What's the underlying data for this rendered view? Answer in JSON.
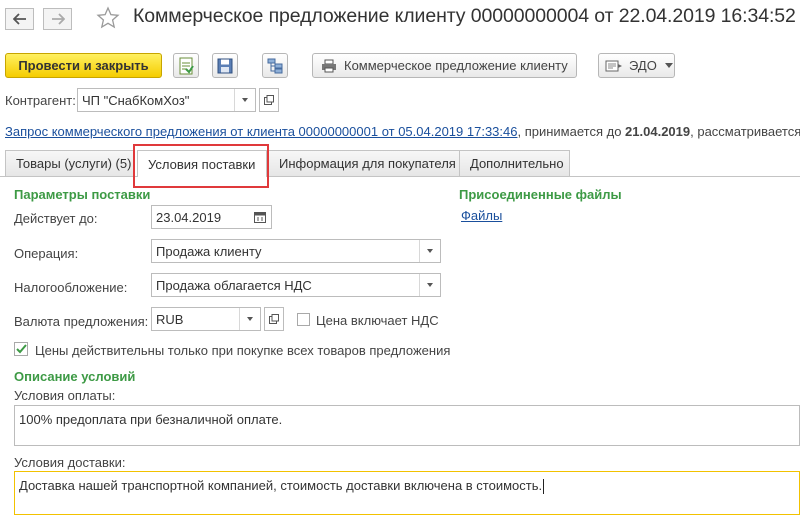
{
  "window": {
    "title": "Коммерческое предложение клиенту 00000000004 от 22.04.2019 16:34:52",
    "icons": {
      "back": "arrow-left-icon",
      "forward": "arrow-right-icon",
      "favorite": "star-icon"
    }
  },
  "toolbar": {
    "post_close_label": "Провести и закрыть",
    "print_label": "Коммерческое предложение клиенту",
    "edo_label": "ЭДО",
    "colors": {
      "primary": "#f5cc00"
    }
  },
  "counterparty": {
    "label": "Контрагент:",
    "value": "ЧП \"СнабКомХоз\""
  },
  "request_line": {
    "link": "Запрос коммерческого предложения от клиента 00000000001 от 05.04.2019 17:33:46",
    "mid_text": ", принимается до ",
    "date": "21.04.2019",
    "tail_text": ", рассматривается"
  },
  "tabs": [
    {
      "label": "Товары (услуги) (5)"
    },
    {
      "label": "Условия поставки"
    },
    {
      "label": "Информация для покупателя"
    },
    {
      "label": "Дополнительно"
    }
  ],
  "delivery_params": {
    "section_title": "Параметры поставки",
    "valid_until_label": "Действует до:",
    "valid_until_value": "23.04.2019",
    "operation_label": "Операция:",
    "operation_value": "Продажа клиенту",
    "taxation_label": "Налогообложение:",
    "taxation_value": "Продажа облагается НДС",
    "currency_label": "Валюта предложения:",
    "currency_value": "RUB",
    "price_vat_label": "Цена включает НДС",
    "price_vat_checked": false,
    "valid_all_label": "Цены действительны только при покупке всех товаров предложения",
    "valid_all_checked": true
  },
  "attached": {
    "section_title": "Присоединенные файлы",
    "files_link": "Файлы"
  },
  "conditions": {
    "section_title": "Описание условий",
    "payment_label": "Условия оплаты:",
    "payment_value": "100% предоплата при безналичной оплате.",
    "delivery_label": "Условия доставки:",
    "delivery_value": "Доставка нашей транспортной компанией, стоимость доставки включена в стоимость."
  }
}
